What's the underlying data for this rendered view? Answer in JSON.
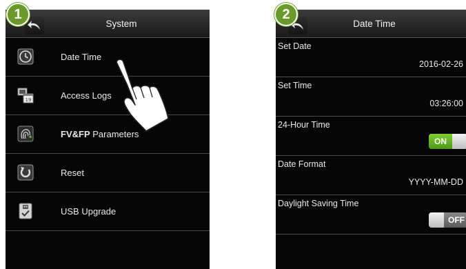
{
  "steps": {
    "step1": "1",
    "step2": "2"
  },
  "system_screen": {
    "title": "System",
    "menu": [
      {
        "label": "Date Time",
        "icon": "clock-icon"
      },
      {
        "label": "Access Logs",
        "icon": "access-logs-icon"
      },
      {
        "label_bold": "FV&FP",
        "label_rest": " Parameters",
        "icon": "fingerprint-icon"
      },
      {
        "label": "Reset",
        "icon": "reset-icon"
      },
      {
        "label": "USB Upgrade",
        "icon": "usb-upgrade-icon"
      }
    ]
  },
  "datetime_screen": {
    "title": "Date Time",
    "set_date": {
      "label": "Set Date",
      "value": "2016-02-26"
    },
    "set_time": {
      "label": "Set Time",
      "value": "03:26:00"
    },
    "hour24": {
      "label": "24-Hour Time",
      "state": "ON"
    },
    "date_format": {
      "label": "Date Format",
      "value": "YYYY-MM-DD"
    },
    "dst": {
      "label": "Daylight Saving Time",
      "state": "OFF"
    }
  },
  "colors": {
    "badge": "#6a9b2a",
    "toggle_on": "#5fb31f",
    "screen_bg": "#060606"
  }
}
